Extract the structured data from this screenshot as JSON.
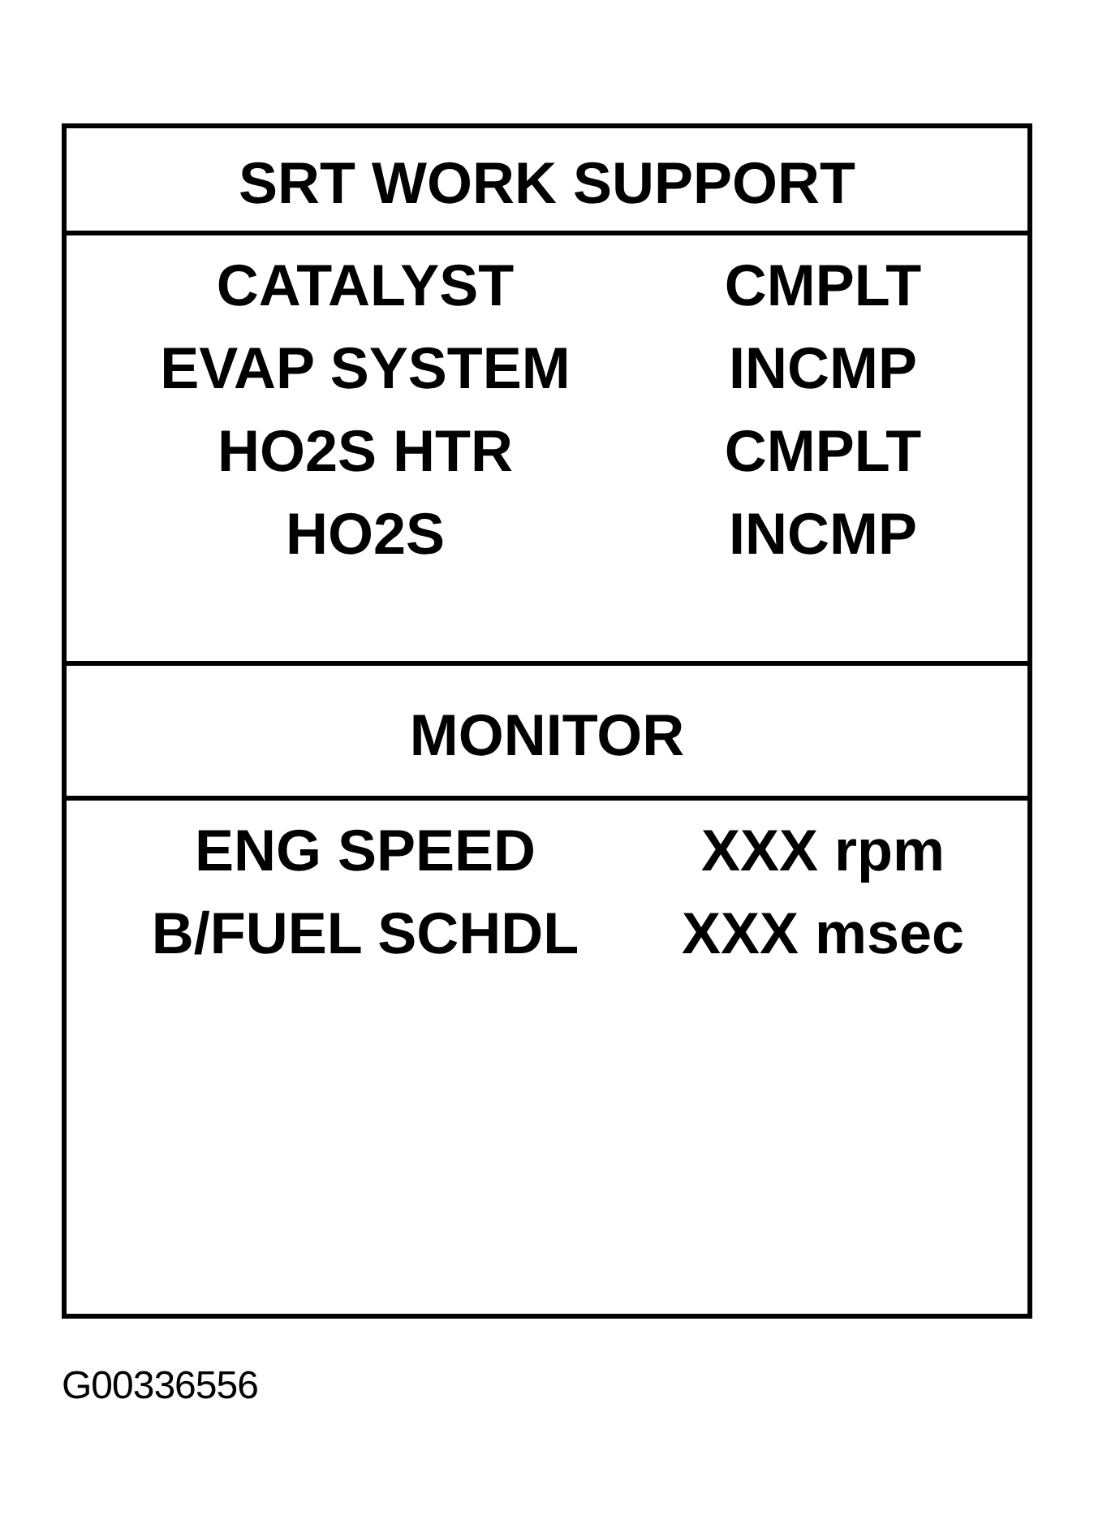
{
  "srt_work_support": {
    "title": "SRT WORK SUPPORT",
    "items": [
      {
        "label": "CATALYST",
        "status": "CMPLT"
      },
      {
        "label": "EVAP SYSTEM",
        "status": "INCMP"
      },
      {
        "label": "HO2S HTR",
        "status": "CMPLT"
      },
      {
        "label": "HO2S",
        "status": "INCMP"
      }
    ]
  },
  "monitor": {
    "title": "MONITOR",
    "items": [
      {
        "label": "ENG SPEED",
        "value": "XXX rpm"
      },
      {
        "label": "B/FUEL SCHDL",
        "value": "XXX msec"
      }
    ]
  },
  "figure_id": "G00336556"
}
